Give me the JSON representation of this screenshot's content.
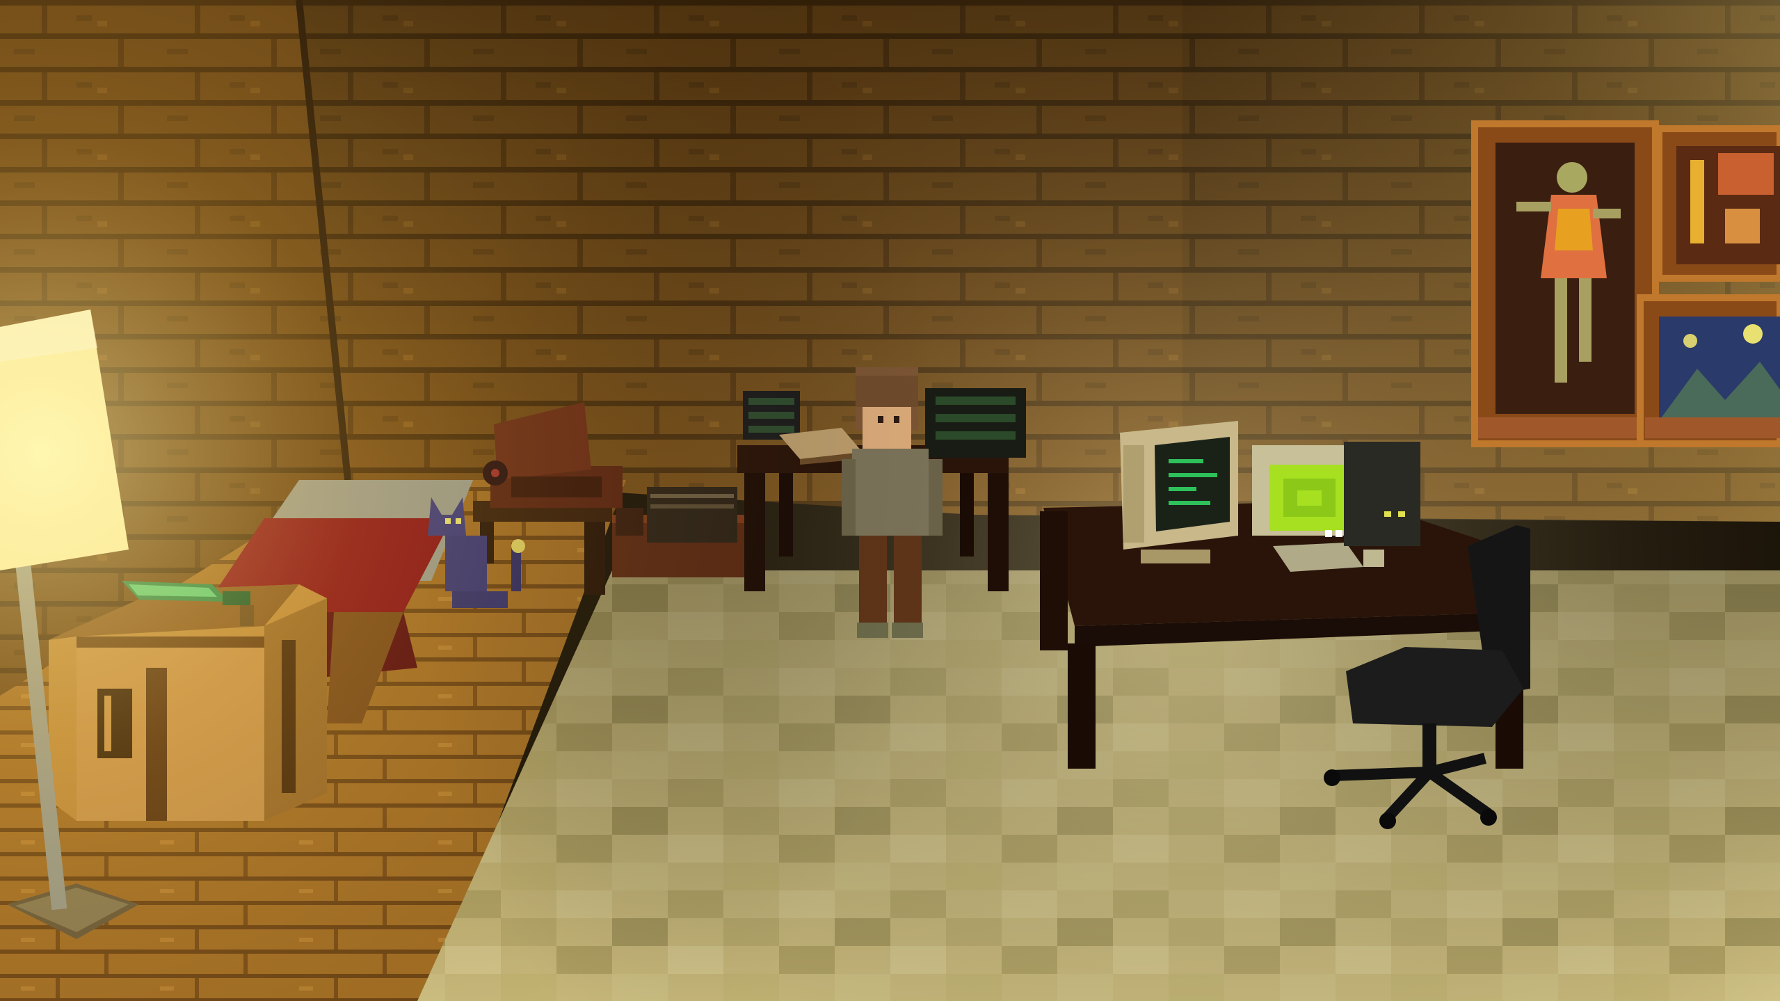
{
  "scene": {
    "description_hidden": "",
    "palette": {
      "wall_plank": "#8a5a1e",
      "wall_dark": "#4a2e0c",
      "floor_wood": "#b07a2a",
      "floor_tile_light": "#d9c889",
      "floor_tile_dark": "#a89a5c",
      "lamp_glow": "#fff7b0",
      "bed_red": "#8e1416",
      "desk_brown": "#2e160c",
      "monitor_green": "#a6e020",
      "terminal_green": "#2ec05a",
      "cat_purple": "#3e3a7a",
      "chair_black": "#151515"
    },
    "objects": [
      {
        "name": "floor-lamp",
        "icon": "lamp-icon"
      },
      {
        "name": "crafting-table",
        "icon": "crafting-table-icon"
      },
      {
        "name": "emerald-sword",
        "icon": "sword-icon"
      },
      {
        "name": "bed",
        "icon": "bed-icon"
      },
      {
        "name": "cat-figure",
        "icon": "cat-icon"
      },
      {
        "name": "record-player",
        "icon": "record-player-icon"
      },
      {
        "name": "record-crate",
        "icon": "crate-icon"
      },
      {
        "name": "back-desk",
        "icon": "desk-icon"
      },
      {
        "name": "player-character",
        "icon": "person-icon"
      },
      {
        "name": "crt-terminal",
        "icon": "monitor-icon"
      },
      {
        "name": "retro-computer",
        "icon": "computer-icon"
      },
      {
        "name": "computer-desk",
        "icon": "desk-icon"
      },
      {
        "name": "office-chair",
        "icon": "chair-icon"
      },
      {
        "name": "dancer-painting",
        "icon": "painting-icon"
      },
      {
        "name": "candle-painting",
        "icon": "painting-icon"
      },
      {
        "name": "night-painting",
        "icon": "painting-icon"
      }
    ]
  }
}
